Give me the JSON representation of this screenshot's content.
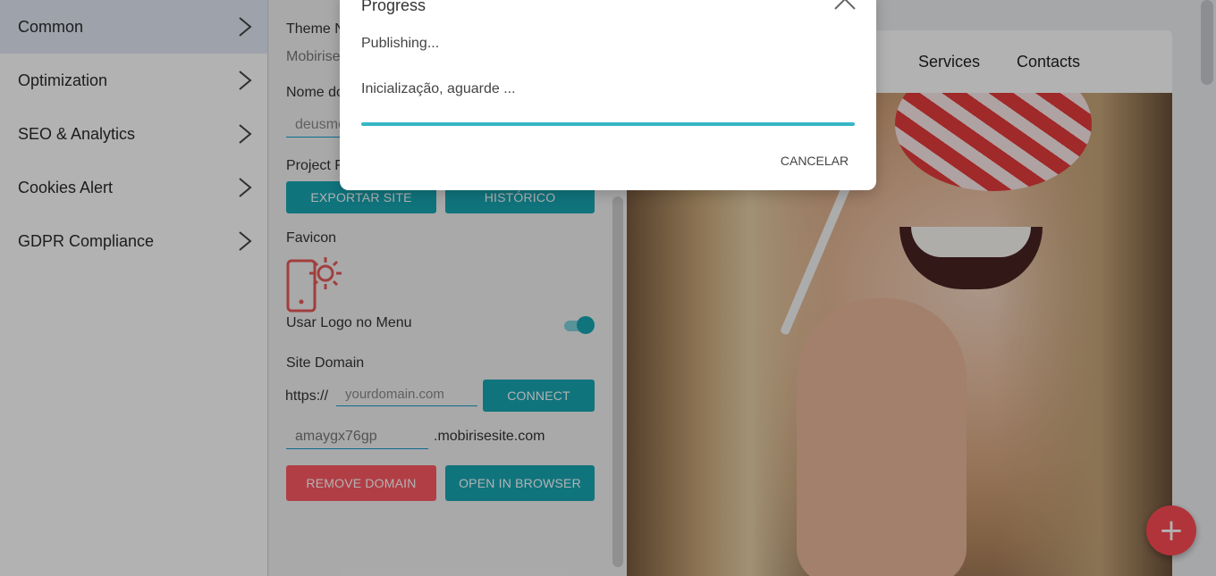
{
  "sidebar": {
    "items": [
      {
        "label": "Common",
        "active": true
      },
      {
        "label": "Optimization"
      },
      {
        "label": "SEO & Analytics"
      },
      {
        "label": "Cookies Alert"
      },
      {
        "label": "GDPR Compliance"
      }
    ]
  },
  "panel": {
    "theme_label": "Theme N",
    "theme_value": "Mobirise",
    "site_name_label": "Nome do",
    "site_name_value": "deusme",
    "project_label": "Project F",
    "export_button": "EXPORTAR SITE",
    "history_button": "HISTÓRICO",
    "favicon_label": "Favicon",
    "use_logo_label": "Usar Logo no Menu",
    "use_logo_enabled": true,
    "site_domain_label": "Site Domain",
    "https_prefix": "https://",
    "domain_placeholder": "yourdomain.com",
    "connect_button": "CONNECT",
    "subdomain_value": "amaygx76gp",
    "subdomain_suffix": ".mobirisesite.com",
    "remove_domain_button": "REMOVE DOMAIN",
    "open_browser_button": "OPEN IN BROWSER"
  },
  "preview": {
    "nav_links": [
      "Services",
      "Contacts"
    ]
  },
  "fab": {
    "icon": "plus-icon",
    "label": "+"
  },
  "modal": {
    "title": "Progress",
    "status": "Publishing...",
    "message": "Inicialização, aguarde ...",
    "progress": 1.0,
    "cancel_button": "CANCELAR"
  },
  "colors": {
    "accent": "#17a7b4",
    "danger": "#ff5a63",
    "fab": "#ff4b55",
    "favicon": "#e85a5a"
  }
}
